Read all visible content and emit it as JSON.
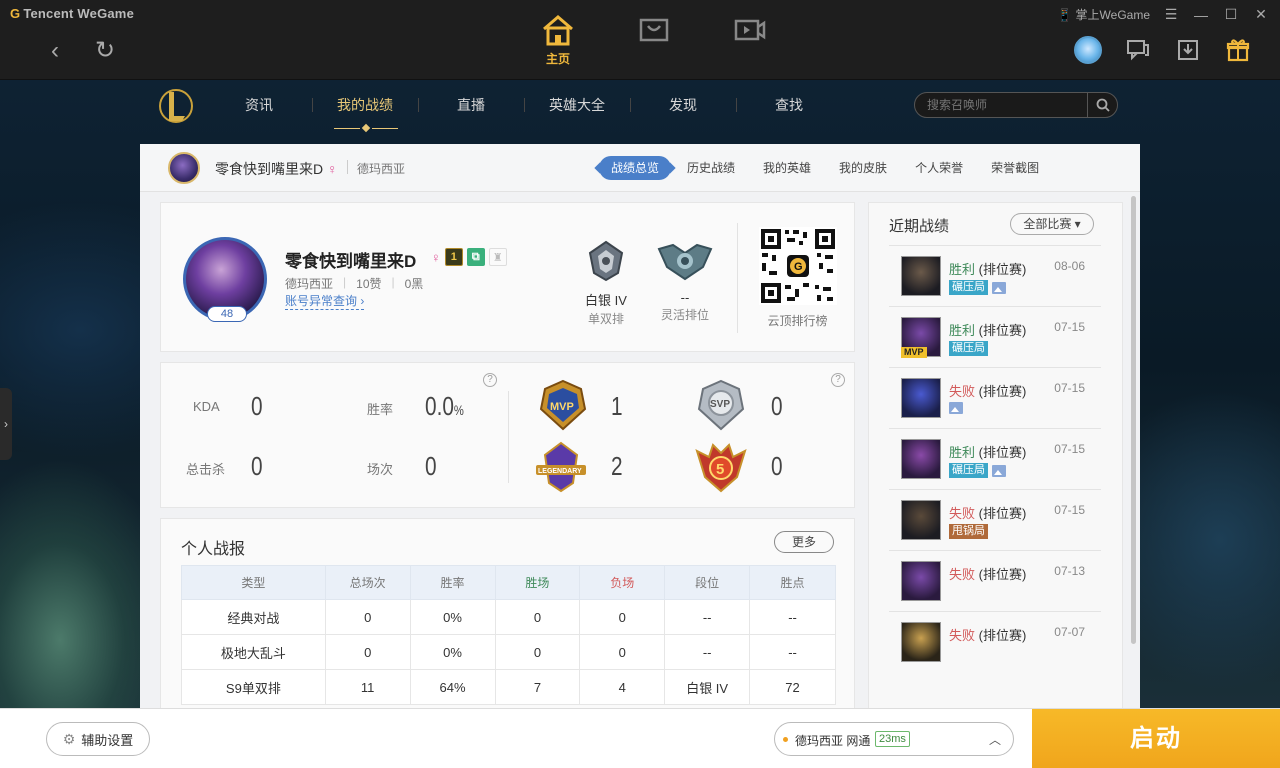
{
  "titlebar": {
    "brand": "Tencent WeGame",
    "center_nav": [
      {
        "label": "主页",
        "icon": "home-icon",
        "active": true
      },
      {
        "label": "",
        "icon": "store-icon",
        "active": false
      },
      {
        "label": "",
        "icon": "video-icon",
        "active": false
      }
    ],
    "mobile_wegame": "掌上WeGame"
  },
  "gamenav": {
    "items": [
      "资讯",
      "我的战绩",
      "直播",
      "英雄大全",
      "发现",
      "查找"
    ],
    "active": "我的战绩",
    "search_placeholder": "搜索召唤师"
  },
  "panel_header": {
    "player_name": "零食快到嘴里来D",
    "gender": "♀",
    "server": "德玛西亚",
    "tabs": [
      "战绩总览",
      "历史战绩",
      "我的英雄",
      "我的皮肤",
      "个人荣誉",
      "荣誉截图"
    ],
    "active_tab": "战绩总览"
  },
  "profile": {
    "name": "零食快到嘴里来D",
    "gender": "♀",
    "level": "48",
    "server": "德玛西亚",
    "likes": "10赞",
    "blacks": "0黑",
    "link": "账号异常查询 ›",
    "badge_one": "1",
    "ranks": [
      {
        "tier": "白银 IV",
        "queue": "单双排"
      },
      {
        "tier": "--",
        "queue": "灵活排位"
      }
    ],
    "qr_label": "云顶排行榜"
  },
  "stats": {
    "kda_label": "KDA",
    "kda": "0",
    "winrate_label": "胜率",
    "winrate": "0.0",
    "winrate_unit": "%",
    "kills_label": "总击杀",
    "kills": "0",
    "games_label": "场次",
    "games": "0",
    "help": "?",
    "medals": {
      "mvp": "1",
      "svp": "0",
      "legendary": "2",
      "penta": "0"
    },
    "penta_num": "5"
  },
  "report": {
    "title": "个人战报",
    "more": "更多",
    "headers": [
      "类型",
      "总场次",
      "胜率",
      "胜场",
      "负场",
      "段位",
      "胜点"
    ],
    "rows": [
      [
        "经典对战",
        "0",
        "0%",
        "0",
        "0",
        "--",
        "--"
      ],
      [
        "极地大乱斗",
        "0",
        "0%",
        "0",
        "0",
        "--",
        "--"
      ],
      [
        "S9单双排",
        "11",
        "64%",
        "7",
        "4",
        "白银 IV",
        "72"
      ]
    ]
  },
  "recent": {
    "title": "近期战绩",
    "filter": "全部比赛 ▾",
    "items": [
      {
        "result": "胜利",
        "win": true,
        "mode": "(排位赛)",
        "date": "08-06",
        "tag": "碾压局",
        "tag_color": "blue",
        "img": true,
        "mvp": false
      },
      {
        "result": "胜利",
        "win": true,
        "mode": "(排位赛)",
        "date": "07-15",
        "tag": "碾压局",
        "tag_color": "blue",
        "img": false,
        "mvp": true
      },
      {
        "result": "失败",
        "win": false,
        "mode": "(排位赛)",
        "date": "07-15",
        "tag": "",
        "tag_color": "",
        "img": true,
        "mvp": false
      },
      {
        "result": "胜利",
        "win": true,
        "mode": "(排位赛)",
        "date": "07-15",
        "tag": "碾压局",
        "tag_color": "blue",
        "img": true,
        "mvp": false
      },
      {
        "result": "失败",
        "win": false,
        "mode": "(排位赛)",
        "date": "07-15",
        "tag": "甩锅局",
        "tag_color": "brown",
        "img": false,
        "mvp": false
      },
      {
        "result": "失败",
        "win": false,
        "mode": "(排位赛)",
        "date": "07-13",
        "tag": "",
        "tag_color": "",
        "img": false,
        "mvp": false
      },
      {
        "result": "失败",
        "win": false,
        "mode": "(排位赛)",
        "date": "07-07",
        "tag": "",
        "tag_color": "",
        "img": false,
        "mvp": false
      }
    ],
    "mvp_label": "MVP"
  },
  "bottom": {
    "assist": "辅助设置",
    "server": "德玛西亚 网通",
    "ping": "23ms",
    "launch": "启动"
  }
}
